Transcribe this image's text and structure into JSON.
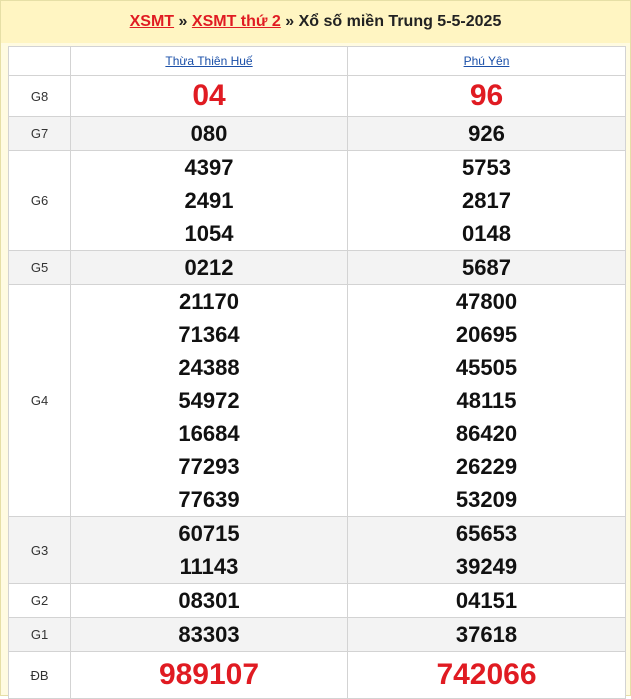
{
  "header": {
    "link1": "XSMT",
    "sep1": "»",
    "link2": "XSMT thứ 2",
    "sep2": "»",
    "title": "Xổ số miền Trung 5-5-2025"
  },
  "provinces": [
    "Thừa Thiên Huế",
    "Phú Yên"
  ],
  "prizes": [
    {
      "label": "G8",
      "p1": [
        "04"
      ],
      "p2": [
        "96"
      ]
    },
    {
      "label": "G7",
      "p1": [
        "080"
      ],
      "p2": [
        "926"
      ]
    },
    {
      "label": "G6",
      "p1": [
        "4397",
        "2491",
        "1054"
      ],
      "p2": [
        "5753",
        "2817",
        "0148"
      ]
    },
    {
      "label": "G5",
      "p1": [
        "0212"
      ],
      "p2": [
        "5687"
      ]
    },
    {
      "label": "G4",
      "p1": [
        "21170",
        "71364",
        "24388",
        "54972",
        "16684",
        "77293",
        "77639"
      ],
      "p2": [
        "47800",
        "20695",
        "45505",
        "48115",
        "86420",
        "26229",
        "53209"
      ]
    },
    {
      "label": "G3",
      "p1": [
        "60715",
        "11143"
      ],
      "p2": [
        "65653",
        "39249"
      ]
    },
    {
      "label": "G2",
      "p1": [
        "08301"
      ],
      "p2": [
        "04151"
      ]
    },
    {
      "label": "G1",
      "p1": [
        "83303"
      ],
      "p2": [
        "37618"
      ]
    },
    {
      "label": "ĐB",
      "p1": [
        "989107"
      ],
      "p2": [
        "742066"
      ]
    }
  ],
  "colors": {
    "accent_red": "#e01b22",
    "link_blue": "#1a4fa8",
    "header_bg": "#fff5c2"
  }
}
